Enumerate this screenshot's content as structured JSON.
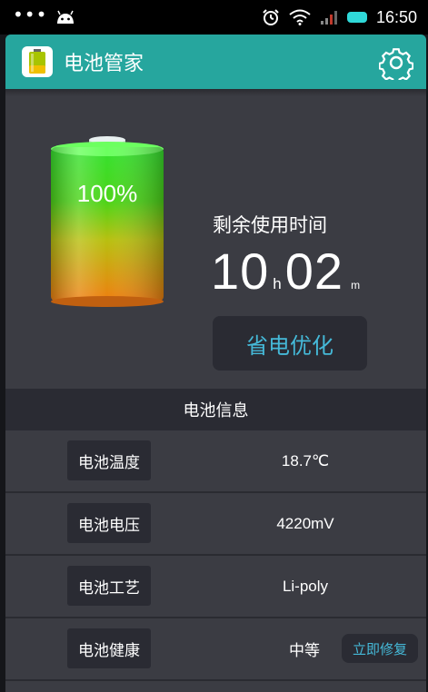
{
  "status_bar": {
    "time": "16:50",
    "left_dots": "•••",
    "icons": [
      "android-icon",
      "alarm-icon",
      "wifi-icon",
      "signal-icon",
      "battery-icon"
    ]
  },
  "app": {
    "title": "电池管家",
    "accent": "#26a69e",
    "icons": [
      "app-battery-icon",
      "gear-icon"
    ]
  },
  "battery": {
    "percent_label": "100%",
    "level": 1.0,
    "remaining_label": "剩余使用时间",
    "hours": "10",
    "hours_unit": "h",
    "minutes": "02",
    "minutes_unit": "m",
    "save_button": "省电优化"
  },
  "info": {
    "header": "电池信息",
    "rows": [
      {
        "label": "电池温度",
        "value": "18.7℃"
      },
      {
        "label": "电池电压",
        "value": "4220mV"
      },
      {
        "label": "电池工艺",
        "value": "Li-poly"
      },
      {
        "label": "电池健康",
        "value": "中等",
        "action": "立即修复"
      }
    ]
  }
}
